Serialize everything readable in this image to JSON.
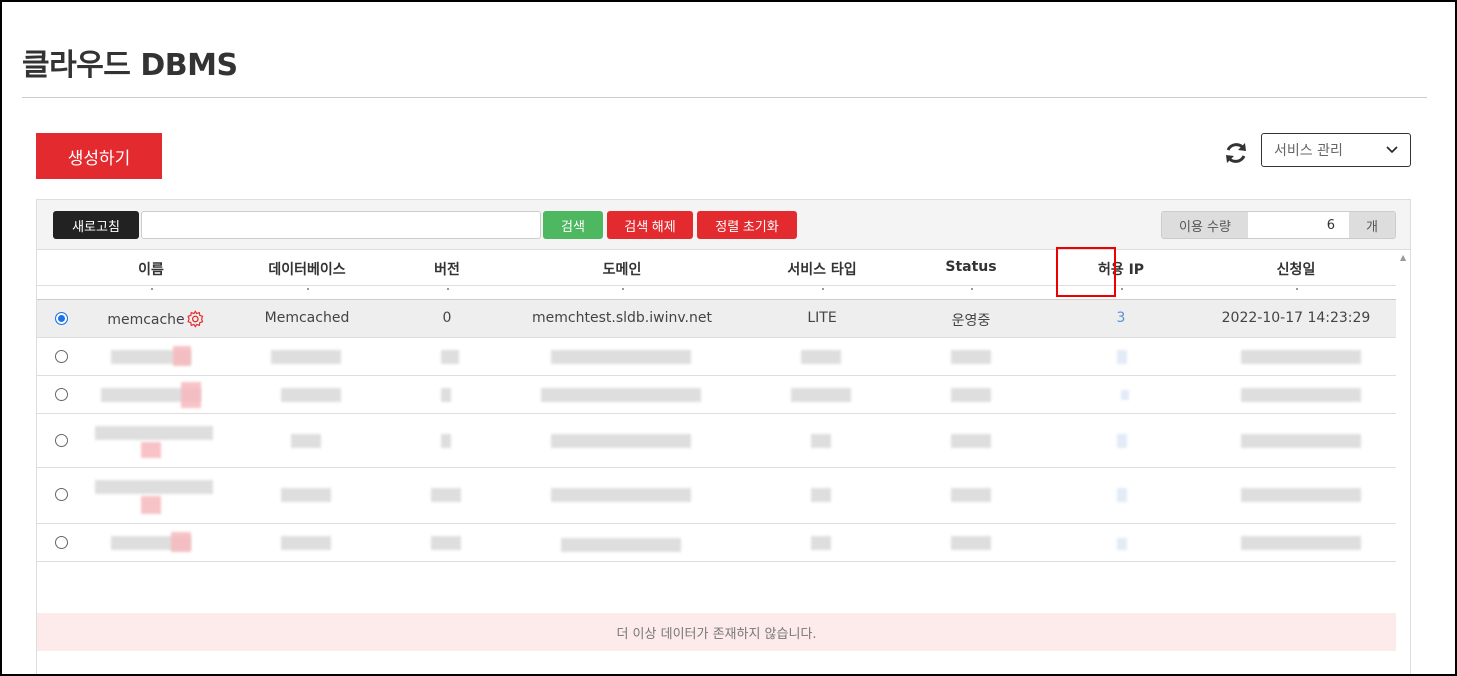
{
  "page": {
    "title": "클라우드 DBMS"
  },
  "actions": {
    "create_label": "생성하기"
  },
  "service_select": {
    "selected": "서비스 관리"
  },
  "toolbar": {
    "refresh_label": "새로고침",
    "search_value": "",
    "search_label": "검색",
    "clear_label": "검색 해제",
    "sort_reset_label": "정렬 초기화",
    "usage_label": "이용 수량",
    "usage_value": "6",
    "usage_unit": "개"
  },
  "table": {
    "columns": [
      "이름",
      "데이터베이스",
      "버전",
      "도메인",
      "서비스 타입",
      "Status",
      "허용 IP",
      "신청일"
    ],
    "rows": [
      {
        "selected": true,
        "name": "memcache",
        "database": "Memcached",
        "version": "0",
        "domain": "memchtest.sldb.iwinv.net",
        "service_type": "LITE",
        "status": "운영중",
        "allowed_ip": "3",
        "created": "2022-10-17 14:23:29"
      }
    ],
    "empty_message": "더 이상 데이터가 존재하지 않습니다."
  },
  "colors": {
    "primary_red": "#e32a2e",
    "search_green": "#4db860",
    "link_blue": "#5b8fd6"
  },
  "icons": [
    "refresh-icon",
    "chevron-down-icon",
    "gear-icon"
  ]
}
